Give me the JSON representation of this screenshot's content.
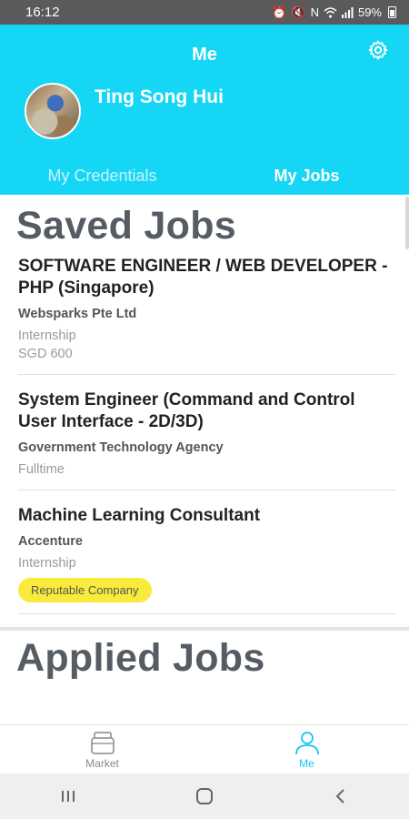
{
  "status_bar": {
    "time": "16:12",
    "battery": "59%",
    "icons": [
      "alarm-icon",
      "mute-icon",
      "nfc-icon",
      "wifi-icon",
      "signal-icon",
      "battery-icon"
    ]
  },
  "header": {
    "title": "Me",
    "user_name": "Ting Song Hui",
    "tabs": [
      {
        "label": "My Credentials",
        "active": false
      },
      {
        "label": "My Jobs",
        "active": true
      }
    ]
  },
  "saved_jobs": {
    "title": "Saved Jobs",
    "items": [
      {
        "title": "SOFTWARE ENGINEER / WEB DEVELOPER - PHP (Singapore)",
        "company": "Websparks Pte Ltd",
        "type": "Internship",
        "salary": "SGD 600"
      },
      {
        "title": "System Engineer (Command and Control User Interface - 2D/3D)",
        "company": "Government Technology Agency",
        "type": "Fulltime"
      },
      {
        "title": "Machine Learning Consultant",
        "company": "Accenture",
        "type": "Internship",
        "badge": "Reputable Company"
      }
    ]
  },
  "applied_jobs": {
    "title": "Applied Jobs"
  },
  "bottom_nav": [
    {
      "label": "Market",
      "icon": "market-icon",
      "active": false
    },
    {
      "label": "Me",
      "icon": "profile-icon",
      "active": true
    }
  ],
  "colors": {
    "brand": "#16d6f6",
    "badge": "#f9ea3b",
    "title_gray": "#555c64"
  }
}
